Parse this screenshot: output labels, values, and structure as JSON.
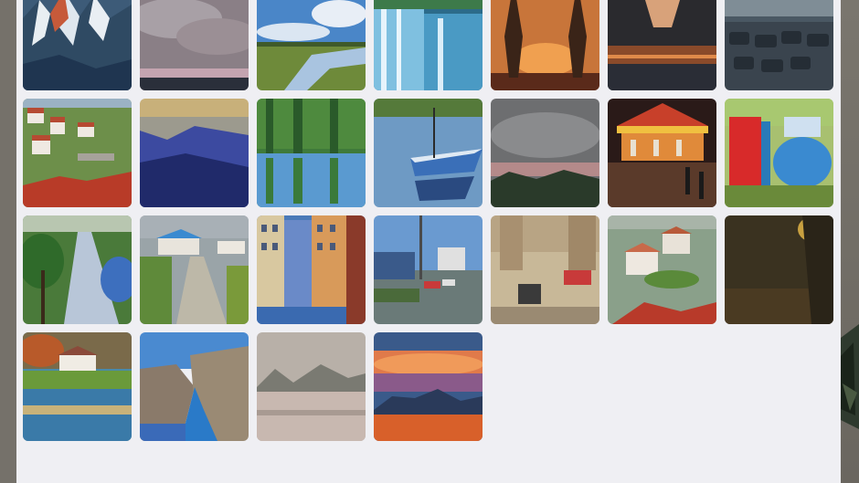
{
  "gallery": {
    "paintings": [
      {
        "id": "painting-mountain-peaks"
      },
      {
        "id": "painting-cloudy-sky"
      },
      {
        "id": "painting-river-landscape"
      },
      {
        "id": "painting-waterfall"
      },
      {
        "id": "painting-sunset-pines"
      },
      {
        "id": "painting-canyon-sunset"
      },
      {
        "id": "painting-parking-lot"
      },
      {
        "id": "painting-hillside-village"
      },
      {
        "id": "painting-blue-hills"
      },
      {
        "id": "painting-green-reflections"
      },
      {
        "id": "painting-blue-boat"
      },
      {
        "id": "painting-gray-dusk"
      },
      {
        "id": "painting-carousel"
      },
      {
        "id": "painting-silos"
      },
      {
        "id": "painting-tree-lined-road"
      },
      {
        "id": "painting-street-houses"
      },
      {
        "id": "painting-city-buildings"
      },
      {
        "id": "painting-harbor-street"
      },
      {
        "id": "painting-city-street-sketch"
      },
      {
        "id": "painting-village-rooftops"
      },
      {
        "id": "painting-dark-tunnel"
      },
      {
        "id": "painting-lakeside-house"
      },
      {
        "id": "painting-canyon-river"
      },
      {
        "id": "painting-misty-lake"
      },
      {
        "id": "painting-sunset-mountains"
      }
    ]
  }
}
